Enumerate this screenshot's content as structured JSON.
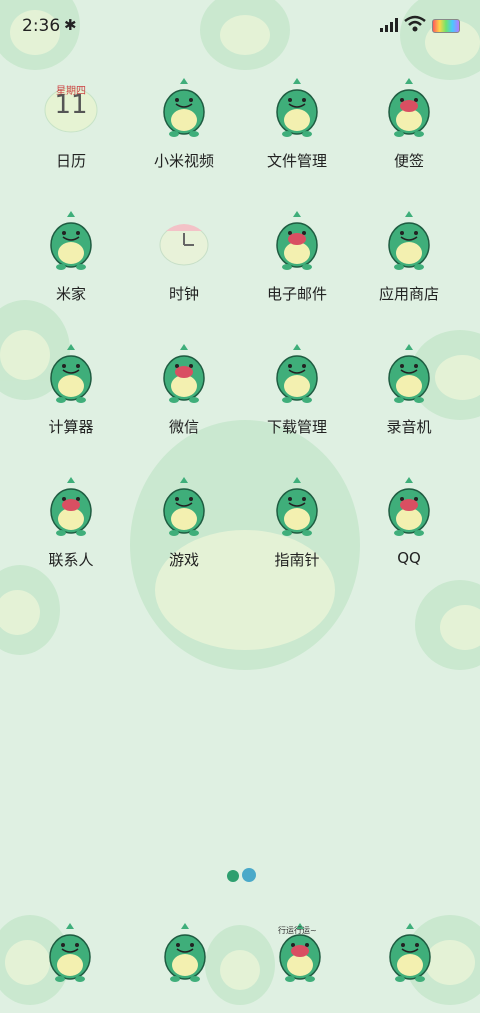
{
  "status_bar": {
    "time": "2:36",
    "bluetooth_icon": "bluetooth-icon",
    "signal_icon": "signal-icon",
    "wifi_icon": "wifi-icon",
    "battery_icon": "battery-icon"
  },
  "calendar": {
    "weekday": "星期四",
    "day": "11"
  },
  "apps": [
    {
      "label": "日历",
      "icon": "calendar-icon"
    },
    {
      "label": "小米视频",
      "icon": "video-icon"
    },
    {
      "label": "文件管理",
      "icon": "file-manager-icon"
    },
    {
      "label": "便签",
      "icon": "notes-icon"
    },
    {
      "label": "米家",
      "icon": "mijia-icon"
    },
    {
      "label": "时钟",
      "icon": "clock-icon"
    },
    {
      "label": "电子邮件",
      "icon": "email-icon"
    },
    {
      "label": "应用商店",
      "icon": "app-store-icon"
    },
    {
      "label": "计算器",
      "icon": "calculator-icon"
    },
    {
      "label": "微信",
      "icon": "wechat-icon"
    },
    {
      "label": "下载管理",
      "icon": "download-manager-icon"
    },
    {
      "label": "录音机",
      "icon": "recorder-icon"
    },
    {
      "label": "联系人",
      "icon": "contacts-icon"
    },
    {
      "label": "游戏",
      "icon": "games-icon"
    },
    {
      "label": "指南针",
      "icon": "compass-icon"
    },
    {
      "label": "QQ",
      "icon": "qq-icon"
    }
  ],
  "page_indicator": {
    "pages": 2,
    "current": 2
  },
  "dock": {
    "items": [
      {
        "icon": "phone-icon"
      },
      {
        "icon": "messages-icon"
      },
      {
        "icon": "browser-icon",
        "caption": "行运行运~"
      },
      {
        "icon": "camera-icon"
      }
    ]
  },
  "colors": {
    "background": "#dff0e2",
    "dino_green": "#3fae7a",
    "dino_belly": "#f3f0b0",
    "label_text": "#222222"
  }
}
